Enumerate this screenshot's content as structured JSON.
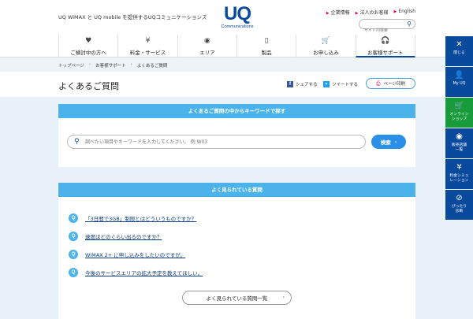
{
  "header": {
    "tagline": "UQ WiMAX と UQ mobile を提供するUQコミュニケーションズ",
    "logo_main": "UQ",
    "logo_sub": "Communications",
    "links": [
      "企業情報",
      "法人のお客様",
      "English"
    ],
    "search_placeholder": "サイト内検索"
  },
  "nav": [
    {
      "label": "ご検討中の方へ",
      "icon": "heart-icon",
      "glyph": "♥"
    },
    {
      "label": "料金・サービス",
      "icon": "yen-icon",
      "glyph": "¥"
    },
    {
      "label": "エリア",
      "icon": "pin-icon",
      "glyph": "◉"
    },
    {
      "label": "製品",
      "icon": "phone-icon",
      "glyph": "▯"
    },
    {
      "label": "お申し込み",
      "icon": "cart-icon",
      "glyph": "🛒"
    },
    {
      "label": "お客様サポート",
      "icon": "headset-icon",
      "glyph": "🎧"
    }
  ],
  "breadcrumb": [
    "トップページ",
    "お客様サポート",
    "よくあるご質問"
  ],
  "page": {
    "title": "よくあるご質問",
    "share_label": "シェアする",
    "tweet_label": "ツイートする",
    "print_label": "ページ印刷"
  },
  "keyword_panel": {
    "heading": "よくあるご質問の中からキーワードで探す",
    "placeholder": "調べたい項目やキーワードを入力してください。 例:W03",
    "button": "検索"
  },
  "popular_panel": {
    "heading": "よく見られている質問",
    "questions": [
      "「3日間で3GB」制限とはどういうものですか？",
      "速度はどのぐらい出るのですか？",
      "WiMAX 2+ に申し込みをしたいのですが。",
      "今後のサービスエリアの拡大予定を教えてほしい。"
    ],
    "more_button": "よく見られている質問一覧"
  },
  "sidebar": [
    {
      "label": "閉じる",
      "icon": "close-icon",
      "glyph": "✕",
      "color": "blue"
    },
    {
      "label": "My UQ",
      "icon": "user-icon",
      "glyph": "👤",
      "color": "blue"
    },
    {
      "label": "オンライン\nショップ",
      "icon": "cart-icon",
      "glyph": "🛒",
      "color": "green"
    },
    {
      "label": "販売店舗\n一覧",
      "icon": "pin-icon",
      "glyph": "◉",
      "color": "blue"
    },
    {
      "label": "料金シミュ\nレーション",
      "icon": "yen-icon",
      "glyph": "¥",
      "color": "blue"
    },
    {
      "label": "ぴったり\n診断",
      "icon": "compass-icon",
      "glyph": "⊘",
      "color": "blue"
    }
  ]
}
